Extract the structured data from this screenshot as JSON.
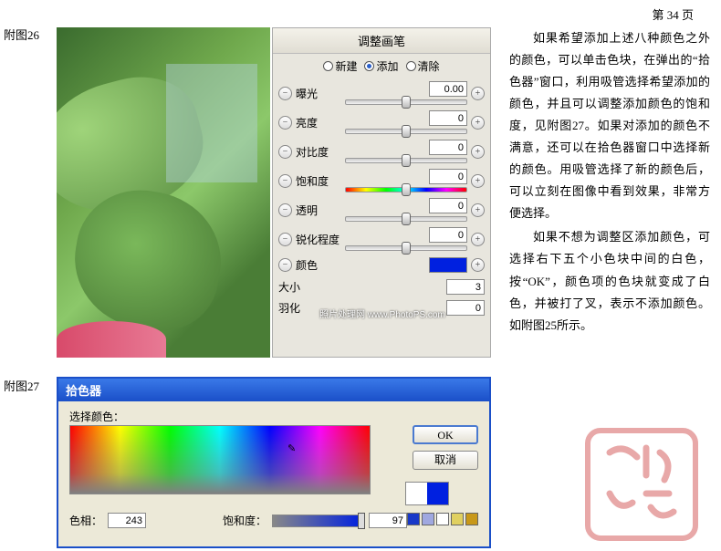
{
  "page_number": "第 34 页",
  "captions": {
    "fig26": "附图26",
    "fig27": "附图27"
  },
  "panel": {
    "title": "调整画笔",
    "radios": {
      "new": "新建",
      "add": "添加",
      "clear": "清除",
      "selected": "add"
    },
    "sliders": {
      "exposure": {
        "label": "曝光",
        "value": "0.00"
      },
      "brightness": {
        "label": "亮度",
        "value": "0"
      },
      "contrast": {
        "label": "对比度",
        "value": "0"
      },
      "saturation": {
        "label": "饱和度",
        "value": "0"
      },
      "clarity": {
        "label": "透明",
        "value": "0"
      },
      "sharpness": {
        "label": "锐化程度",
        "value": "0"
      }
    },
    "color": {
      "label": "颜色",
      "value": "#0020e0"
    },
    "size": {
      "label": "大小",
      "value": "3"
    },
    "feather": {
      "label": "羽化",
      "value": "0"
    },
    "watermark": "照片处理网 www.PhotoPS.com"
  },
  "body_text": {
    "p1": "如果希望添加上述八种颜色之外的颜色，可以单击色块，在弹出的“拾色器”窗口，利用吸管选择希望添加的颜色，并且可以调整添加颜色的饱和度，见附图27。如果对添加的颜色不满意，还可以在拾色器窗口中选择新的颜色。用吸管选择了新的颜色后，可以立刻在图像中看到效果，非常方便选择。",
    "p2": "如果不想为调整区添加颜色，可选择右下五个小色块中间的白色，按“OK”，颜色项的色块就变成了白色，并被打了叉，表示不添加颜色。如附图25所示。"
  },
  "picker": {
    "title": "拾色器",
    "select_label": "选择颜色：",
    "ok": "OK",
    "cancel": "取消",
    "hue": {
      "label": "色相：",
      "value": "243"
    },
    "sat": {
      "label": "饱和度：",
      "value": "97"
    },
    "presets": [
      "#1838c8",
      "#a0a8e0",
      "#ffffff",
      "#e0d060",
      "#c89818"
    ],
    "result": {
      "left": "#ffffff",
      "right": "#0020e0"
    }
  }
}
